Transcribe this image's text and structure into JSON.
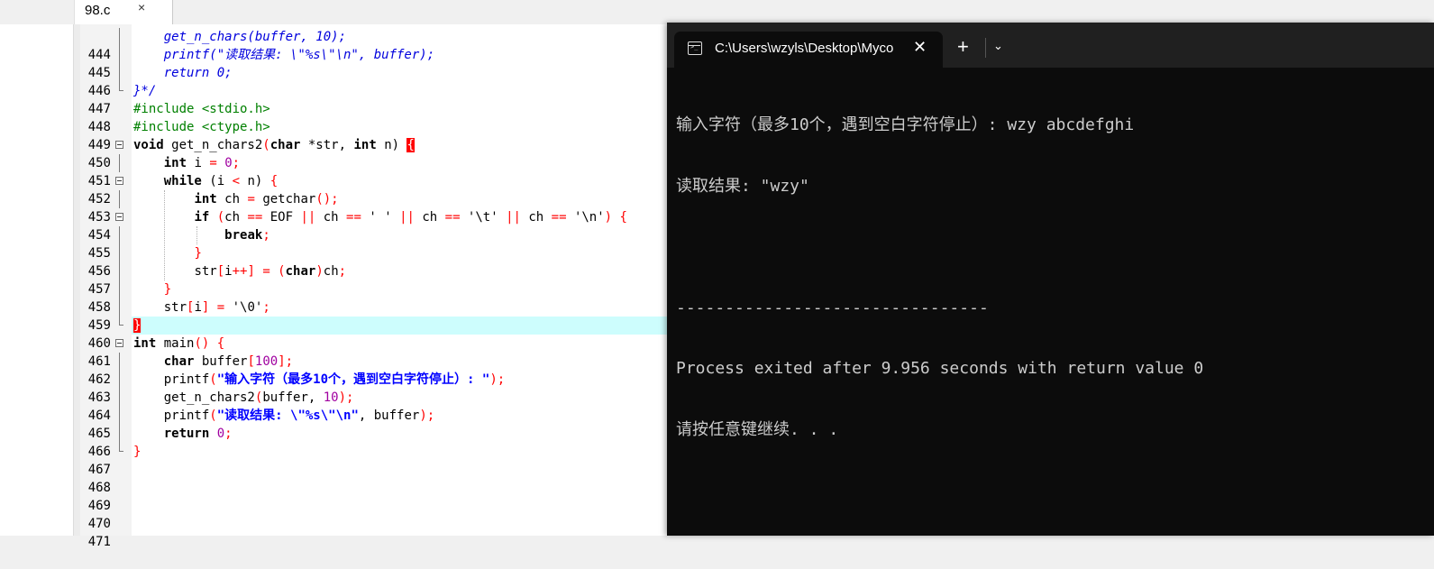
{
  "editor": {
    "tab": {
      "name": "98.c",
      "close": "×"
    },
    "lines": [
      {
        "num": "444"
      },
      {
        "num": "445"
      },
      {
        "num": "446"
      },
      {
        "num": "447"
      },
      {
        "num": "448"
      },
      {
        "num": "449"
      },
      {
        "num": "450"
      },
      {
        "num": "451"
      },
      {
        "num": "452"
      },
      {
        "num": "453"
      },
      {
        "num": "454"
      },
      {
        "num": "455"
      },
      {
        "num": "456"
      },
      {
        "num": "457"
      },
      {
        "num": "458"
      },
      {
        "num": "459"
      },
      {
        "num": "460"
      },
      {
        "num": "461"
      },
      {
        "num": "462"
      },
      {
        "num": "463"
      },
      {
        "num": "464"
      },
      {
        "num": "465"
      },
      {
        "num": "466"
      },
      {
        "num": "467"
      },
      {
        "num": "468"
      },
      {
        "num": "469"
      },
      {
        "num": "470"
      },
      {
        "num": "471"
      }
    ],
    "code": {
      "l444": "get_n_chars(buffer, 10);",
      "l445": "printf(\"读取结果: \\\"%s\\\"\\n\", buffer);",
      "l446": "return 0;",
      "l447": "}*/",
      "l448": "#include <stdio.h>",
      "l449": "#include <ctype.h>",
      "l450": {
        "kw1": "void",
        "fn": " get_n_chars2",
        "p1": "(",
        "kw2": "char",
        "v1": " *str, ",
        "kw3": "int",
        "v2": " n) ",
        "brace": "{"
      },
      "l451": {
        "kw": "int",
        "rest1": " i ",
        "op": "=",
        "sp": " ",
        "num": "0",
        "end": ";"
      },
      "l452": {
        "kw": "while",
        "rest": " (i ",
        "op1": "<",
        "rest2": " n) ",
        "op2": "{"
      },
      "l453": {
        "kw": "int",
        "rest": " ch ",
        "op": "=",
        "rest2": " getchar",
        "op2": "();"
      },
      "l454": {
        "kw": "if",
        "p1": " (",
        "a": "ch ",
        "eq1": "==",
        "b": " EOF ",
        "or1": "||",
        "c": " ch ",
        "eq2": "==",
        "d": " ' ' ",
        "or2": "||",
        "e": " ch ",
        "eq3": "==",
        "f": " '\\t' ",
        "or3": "||",
        "g": " ch ",
        "eq4": "==",
        "h": " '\\n'",
        "p2": ") {"
      },
      "l455": {
        "kw": "break",
        "end": ";"
      },
      "l456": {
        "brace": "}"
      },
      "l457": {
        "a": "str",
        "op1": "[",
        "b": "i",
        "op2": "++] = (",
        "kw": "char",
        "op3": ")",
        "c": "ch",
        "end": ";"
      },
      "l458": {
        "brace": "}"
      },
      "l459": {
        "a": "str",
        "op1": "[",
        "b": "i",
        "op2": "] = ",
        "c": "'\\0'",
        "end": ";"
      },
      "l460": {
        "brace": "}"
      },
      "l461": {
        "kw": "int",
        "rest": " main",
        "op": "() {"
      },
      "l462": {
        "kw": "char",
        "rest": " buffer",
        "op1": "[",
        "num": "100",
        "op2": "];"
      },
      "l463": {
        "fn": "printf",
        "op1": "(",
        "str": "\"输入字符（最多10个，遇到空白字符停止）: \"",
        "op2": ");"
      },
      "l464": {
        "fn": "get_n_chars2",
        "op1": "(",
        "a": "buffer, ",
        "num": "10",
        "op2": ");"
      },
      "l465": {
        "fn": "printf",
        "op1": "(",
        "str": "\"读取结果: \\\"%s\\\"\\n\"",
        "a": ", buffer",
        "op2": ");"
      },
      "l466": {
        "kw": "return",
        "sp": " ",
        "num": "0",
        "end": ";"
      },
      "l467": {
        "brace": "}"
      }
    }
  },
  "terminal": {
    "tab_title": "C:\\Users\\wzyls\\Desktop\\Myco",
    "tab_close": "✕",
    "add_label": "+",
    "dropdown_label": "⌄",
    "output": [
      "输入字符（最多10个，遇到空白字符停止）: wzy abcdefghi",
      "读取结果: \"wzy\"",
      "",
      "--------------------------------",
      "Process exited after 9.956 seconds with return value 0",
      "请按任意键继续. . ."
    ]
  }
}
